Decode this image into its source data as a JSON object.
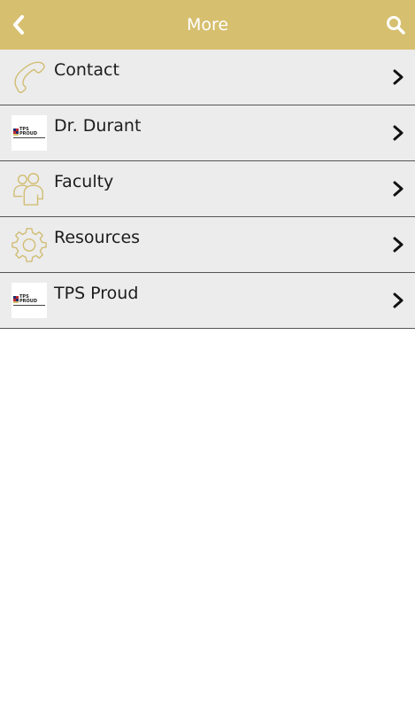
{
  "header": {
    "title": "More",
    "back_icon": "chevron-left-icon",
    "search_icon": "search-icon"
  },
  "colors": {
    "accent": "#d6bf6f",
    "row_bg": "#ececec",
    "divider": "#555555",
    "chevron": "#111111"
  },
  "logo": {
    "line1": "TPS",
    "line2": "PROUD"
  },
  "items": [
    {
      "label": "Contact",
      "icon": "phone-icon"
    },
    {
      "label": "Dr. Durant",
      "icon": "tps-proud-logo"
    },
    {
      "label": "Faculty",
      "icon": "people-icon"
    },
    {
      "label": "Resources",
      "icon": "gear-icon"
    },
    {
      "label": "TPS Proud",
      "icon": "tps-proud-logo"
    }
  ]
}
